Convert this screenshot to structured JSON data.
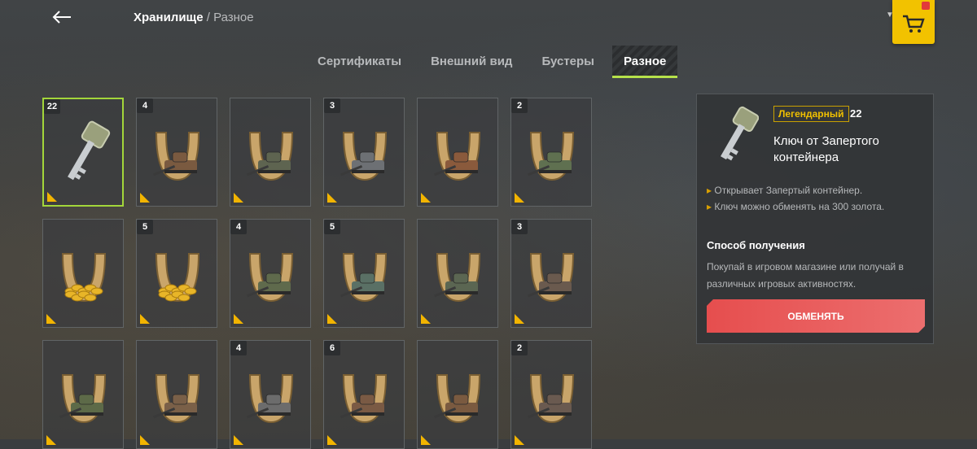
{
  "breadcrumb": {
    "section": "Хранилище",
    "separator": "/",
    "current": "Разное"
  },
  "tabs": [
    {
      "label": "Сертификаты",
      "active": false
    },
    {
      "label": "Внешний вид",
      "active": false
    },
    {
      "label": "Бустеры",
      "active": false
    },
    {
      "label": "Разное",
      "active": true
    }
  ],
  "items": [
    {
      "count": "22",
      "kind": "key",
      "selected": true
    },
    {
      "count": "4",
      "kind": "tank",
      "tint": "#7a5a40"
    },
    {
      "count": "",
      "kind": "tank",
      "tint": "#5e6450"
    },
    {
      "count": "3",
      "kind": "tank",
      "tint": "#6d7074"
    },
    {
      "count": "",
      "kind": "tank",
      "tint": "#8a5a3c"
    },
    {
      "count": "2",
      "kind": "tank",
      "tint": "#5f7050"
    },
    {
      "count": "",
      "kind": "gold"
    },
    {
      "count": "5",
      "kind": "gold"
    },
    {
      "count": "4",
      "kind": "tank",
      "tint": "#5f6a4c"
    },
    {
      "count": "5",
      "kind": "tank",
      "tint": "#5a7065"
    },
    {
      "count": "",
      "kind": "tank",
      "tint": "#5b6652"
    },
    {
      "count": "3",
      "kind": "tank",
      "tint": "#6a5a4e"
    },
    {
      "count": "",
      "kind": "tank",
      "tint": "#5d6a48"
    },
    {
      "count": "",
      "kind": "tank",
      "tint": "#7a6048"
    },
    {
      "count": "4",
      "kind": "tank",
      "tint": "#6c6c6c"
    },
    {
      "count": "6",
      "kind": "tank",
      "tint": "#7a5a44"
    },
    {
      "count": "",
      "kind": "tank",
      "tint": "#7a5a40"
    },
    {
      "count": "2",
      "kind": "tank",
      "tint": "#6a5a50"
    }
  ],
  "detail": {
    "rarity": "Легендарный",
    "count": "22",
    "title": "Ключ от Запертого контейнера",
    "bullets": [
      "Открывает Запертый контейнер.",
      "Ключ можно обменять на 300 золота."
    ],
    "section_title": "Способ получения",
    "section_desc": "Покупай в игровом магазине или получай в различных игровых активностях.",
    "button_label": "ОБМЕНЯТЬ"
  },
  "colors": {
    "accent": "#b6e14a",
    "selected_border": "#a3d63a",
    "rarity": "#f0c000",
    "button": "#e64e4e",
    "shop": "#f2c200"
  },
  "icons": {
    "back": "arrow-left-icon",
    "shop": "shopping-cart-icon"
  }
}
